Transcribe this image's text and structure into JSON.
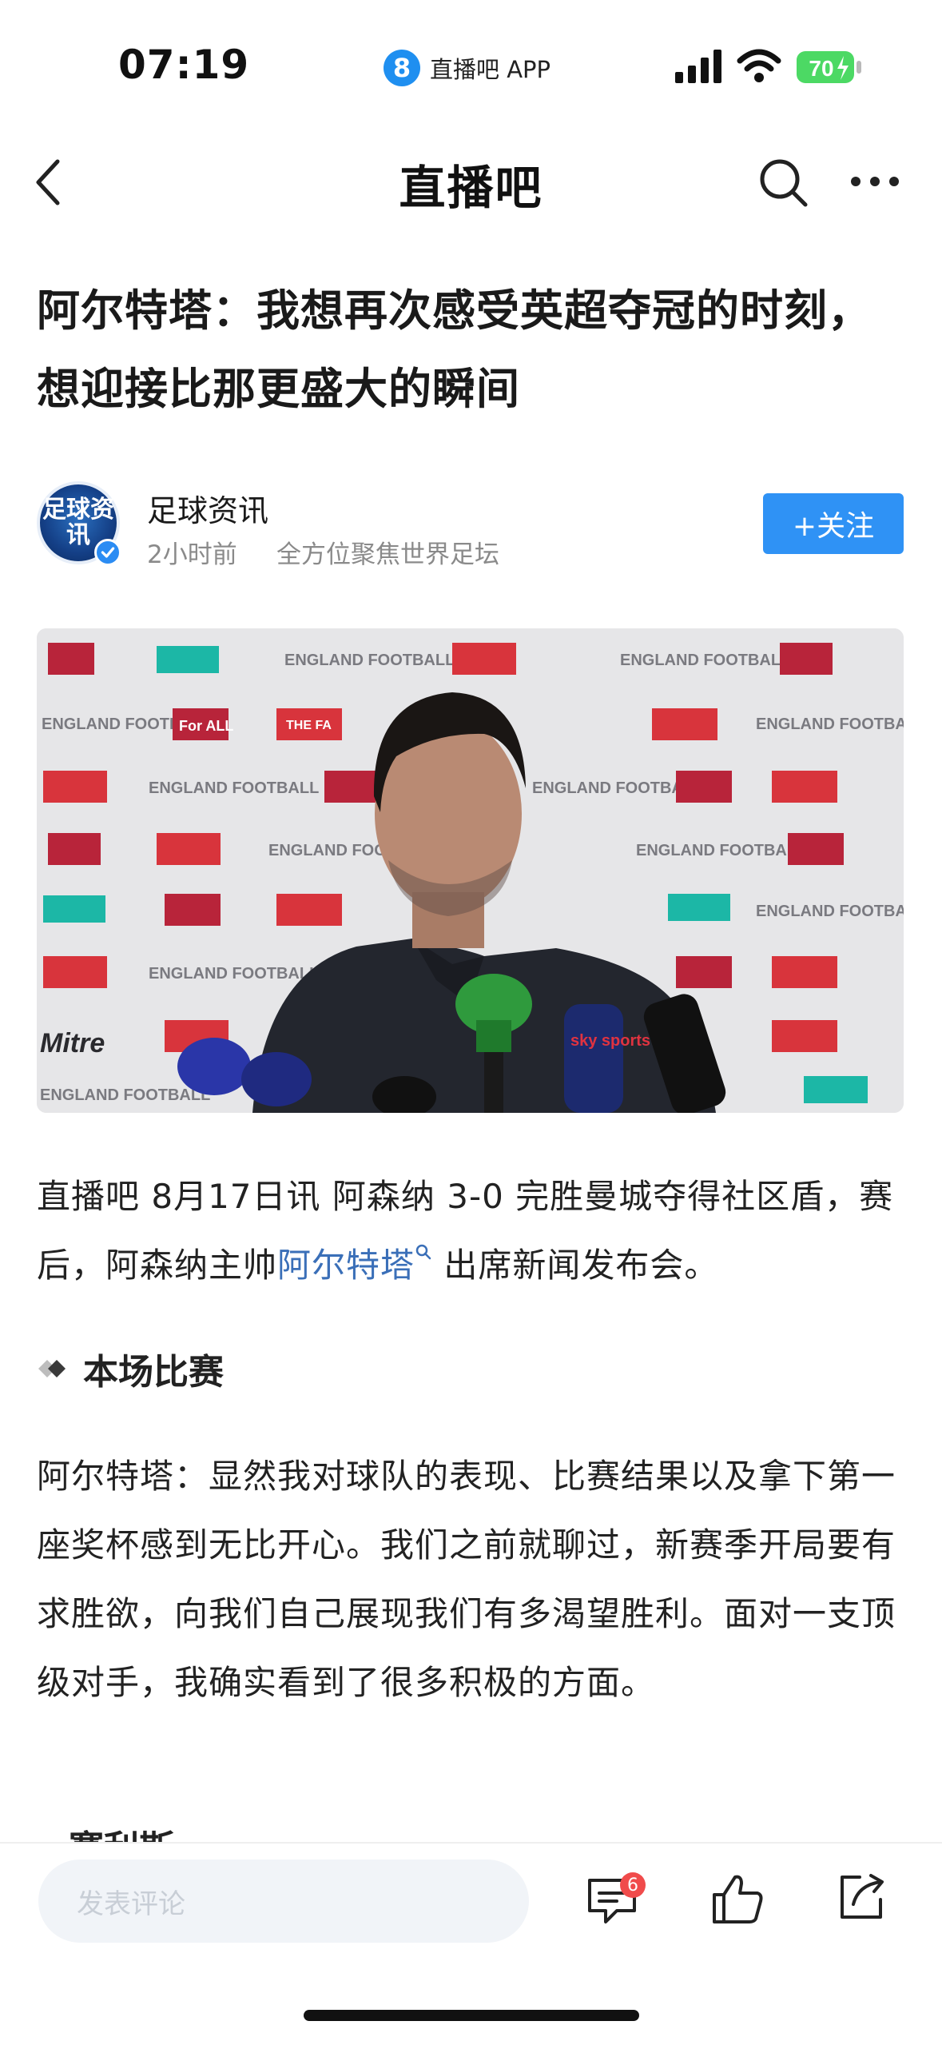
{
  "status_bar": {
    "time": "07:19",
    "app_badge": "8",
    "app_name": "直播吧 APP",
    "battery": "70"
  },
  "nav": {
    "title": "直播吧",
    "icons": [
      "back-icon",
      "search-icon",
      "more-icon"
    ]
  },
  "article": {
    "headline": "阿尔特塔：我想再次感受英超夺冠的时刻，想迎接比那更盛大的瞬间",
    "author": {
      "avatar_text": "足球资讯",
      "name": "足球资讯",
      "time": "2小时前",
      "desc": "全方位聚焦世界足坛",
      "follow_label": "+关注"
    },
    "para1_a": "直播吧 8月17日讯  阿森纳 3-0 完胜曼城夺得社区盾，赛后，阿森纳主帅",
    "para1_link": "阿尔特塔",
    "para1_b": " 出席新闻发布会。",
    "section_title": "本场比赛",
    "para2": "阿尔特塔：显然我对球队的表现、比赛结果以及拿下第一座奖杯感到无比开心。我们之前就聊过，新赛季开局要有求胜欲，向我们自己展现我们有多渴望胜利。面对一支顶级对手，我确实看到了很多积极的方面。",
    "next_section_partial": "赛利斯"
  },
  "photo_backdrop": {
    "logo_a": "ENGLAND FOOTBALL",
    "logo_b": "For ALL",
    "logo_c": "THE FA",
    "logo_d": "Mitre",
    "mic_label": "sky sports"
  },
  "bottom_bar": {
    "comment_placeholder": "发表评论",
    "comment_count": "6"
  },
  "colors": {
    "accent": "#2f92f5",
    "link": "#3a6fb8",
    "badge": "#f04b4b",
    "battery": "#4cd964"
  }
}
